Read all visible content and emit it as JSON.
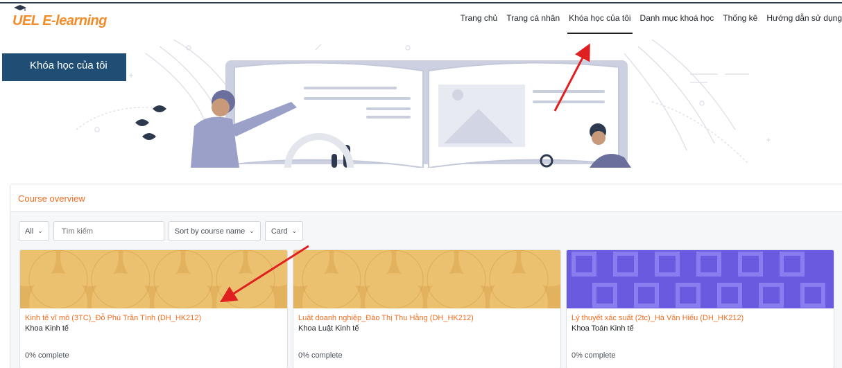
{
  "brand": {
    "logo_text": "UEL E-learning"
  },
  "nav": {
    "items": [
      {
        "label": "Trang chủ",
        "active": false
      },
      {
        "label": "Trang cá nhân",
        "active": false
      },
      {
        "label": "Khóa học của tôi",
        "active": true
      },
      {
        "label": "Danh mục khoá học",
        "active": false
      },
      {
        "label": "Thống kê",
        "active": false
      },
      {
        "label": "Hướng dẫn sử dụng",
        "active": false
      }
    ]
  },
  "banner": {
    "page_title": "Khóa học của tôi"
  },
  "overview": {
    "heading": "Course overview",
    "filter_label": "All",
    "search_placeholder": "Tìm kiếm",
    "sort_label": "Sort by course name",
    "view_label": "Card"
  },
  "courses": [
    {
      "title": "Kinh tế vĩ mô (3TC)_Đỗ Phú Trần Tình (DH_HK212)",
      "category": "Khoa Kinh tế",
      "progress": "0% complete",
      "pattern": "circles-gold"
    },
    {
      "title": "Luật doanh nghiệp_Đào Thị Thu Hằng (DH_HK212)",
      "category": "Khoa Luật Kinh tế",
      "progress": "0% complete",
      "pattern": "circles-gold"
    },
    {
      "title": "Lý thuyết xác suất (2tc)_Hà Văn Hiếu (DH_HK212)",
      "category": "Khoa Toán Kinh tế",
      "progress": "0% complete",
      "pattern": "squares-purple"
    }
  ],
  "colors": {
    "accent": "#f26d21",
    "title_box": "#1f4d73",
    "gold": "#e6b965",
    "purple": "#6a5ae0",
    "annotation": "#e02020"
  }
}
